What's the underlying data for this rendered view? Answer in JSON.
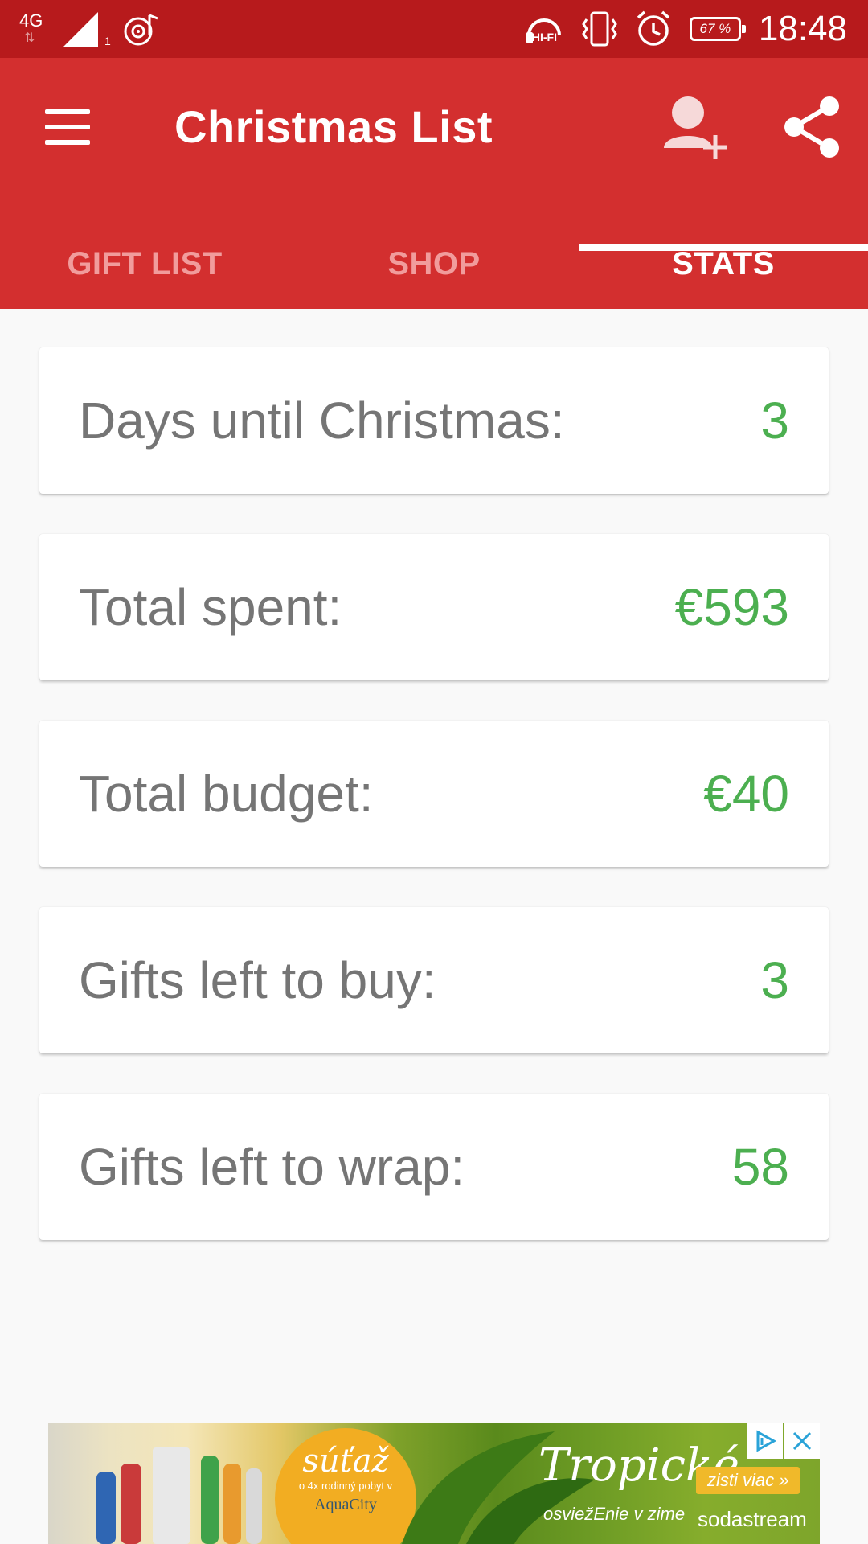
{
  "status_bar": {
    "network": "4G",
    "sim": "1",
    "battery": "67 %",
    "time": "18:48",
    "hifi": "HI-FI",
    "icons": [
      "signal-icon",
      "music-icon",
      "headphones-hifi-icon",
      "vibrate-icon",
      "alarm-icon",
      "battery-icon"
    ]
  },
  "app_bar": {
    "title": "Christmas List",
    "icons": [
      "menu-icon",
      "add-person-icon",
      "share-icon"
    ]
  },
  "tabs": [
    {
      "label": "GIFT LIST",
      "active": false
    },
    {
      "label": "SHOP",
      "active": false
    },
    {
      "label": "STATS",
      "active": true
    }
  ],
  "stats": [
    {
      "label": "Days until Christmas:",
      "value": "3"
    },
    {
      "label": "Total spent:",
      "value": "€593"
    },
    {
      "label": "Total budget:",
      "value": "€40"
    },
    {
      "label": "Gifts left to buy:",
      "value": "3"
    },
    {
      "label": "Gifts left to wrap:",
      "value": "58"
    }
  ],
  "ad": {
    "badge_title": "súťaž",
    "badge_text": "o 4x rodinný pobyt v",
    "badge_brand": "AquaCity",
    "headline": "Tropické",
    "subline": "osviežEnie v zime",
    "cta": "zisti viac »",
    "brand": "sodastream",
    "icons": [
      "adchoices-icon",
      "close-icon"
    ]
  },
  "colors": {
    "status_bar": "#b71a1c",
    "primary": "#d32f2f",
    "tab_inactive": "#f19c9c",
    "value_green": "#4caf50",
    "label_gray": "#757575",
    "background": "#f9f9f9"
  }
}
